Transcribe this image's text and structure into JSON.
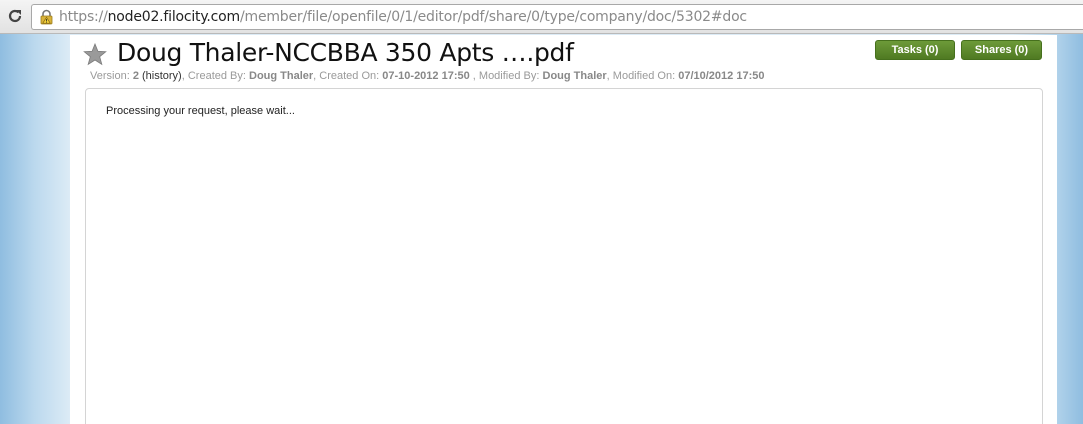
{
  "browser": {
    "url_scheme": "https://",
    "url_host": "node02.filocity.com",
    "url_path": "/member/file/openfile/0/1/editor/pdf/share/0/type/company/doc/5302#doc"
  },
  "document": {
    "title": "Doug Thaler-NCCBBA 350 Apts ….pdf",
    "meta": {
      "version_label": "Version: ",
      "version": "2",
      "history_link": "(history)",
      "created_by_label": ", Created By: ",
      "created_by": "Doug Thaler",
      "created_on_label": ", Created On: ",
      "created_on": "07-10-2012 17:50",
      "modified_by_label": " , Modified By: ",
      "modified_by": "Doug Thaler",
      "modified_on_label": ", Modified On: ",
      "modified_on": "07/10/2012 17:50"
    },
    "buttons": {
      "tasks": "Tasks (0)",
      "shares": "Shares (0)"
    },
    "status_text": "Processing your request, please wait..."
  },
  "colors": {
    "button_green": "#5b8a2c",
    "side_blue": "#8fbde0"
  }
}
